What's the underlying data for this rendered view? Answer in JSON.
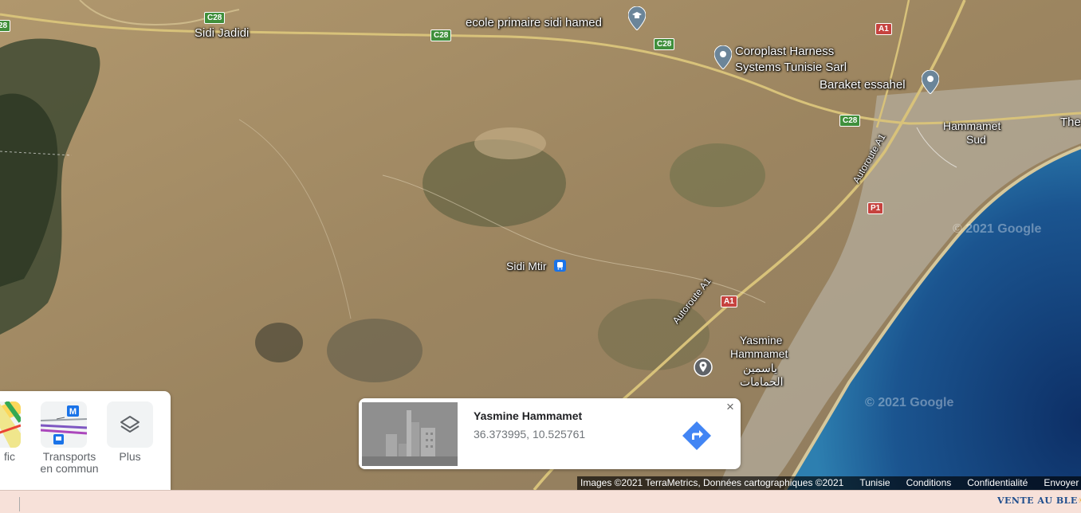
{
  "map": {
    "places": {
      "sidi_jadidi": "Sidi Jadidi",
      "ecole": "ecole primaire sidi hamed",
      "coroplast_1": "Coroplast Harness",
      "coroplast_2": "Systems Tunisie Sarl",
      "baraket": "Baraket essahel",
      "hammamet_sud_1": "Hammamet",
      "hammamet_sud_2": "Sud",
      "the": "The",
      "sidi_mtir": "Sidi Mtir",
      "yasmine_1": "Yasmine",
      "yasmine_2": "Hammamet",
      "yasmine_ar_1": "ياسمين",
      "yasmine_ar_2": "الحمامات",
      "autoroute_1": "Autoroute A1",
      "autoroute_2": "Autoroute A1"
    },
    "shields": {
      "c28_a": "28",
      "c28_b": "C28",
      "c28_c": "C28",
      "c28_d": "C28",
      "c28_e": "C28",
      "a1_a": "A1",
      "a1_b": "A1",
      "p1": "P1"
    },
    "watermarks": [
      "© 2021 Google",
      "© 2021 Google"
    ]
  },
  "layers": {
    "items": [
      {
        "label": "fic"
      },
      {
        "label": "Transports en commun"
      },
      {
        "label": "Plus"
      }
    ],
    "transit_badge": "M"
  },
  "card": {
    "title": "Yasmine Hammamet",
    "coords": "36.373995, 10.525761",
    "close": "×"
  },
  "attribution": {
    "imagery": "Images ©2021 TerraMetrics, Données cartographiques ©2021",
    "country": "Tunisie",
    "terms": "Conditions",
    "privacy": "Confidentialité",
    "feedback": "Envoyer des commentaires"
  },
  "bottombar": {
    "logo_1": "VENTE AU BLE",
    "logo_sun": "☀"
  },
  "colors": {
    "sea": "#1a4f86",
    "land": "#a08a62",
    "road": "#d8c27a",
    "directions": "#4285f4"
  }
}
